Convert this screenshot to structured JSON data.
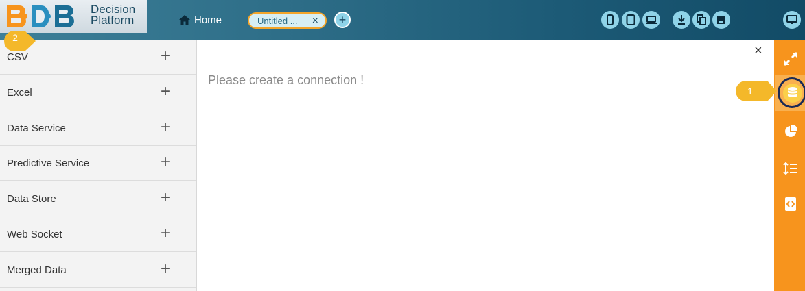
{
  "header": {
    "logo_line1": "Decision",
    "logo_line2": "Platform",
    "home_label": "Home",
    "tab_label": "Untitled ...",
    "tab_close": "×",
    "add_tab": "+"
  },
  "toolbar": {
    "buttons": [
      "mobile-view",
      "tablet-view",
      "laptop-view",
      "download",
      "copy",
      "save",
      "preview"
    ]
  },
  "left_panel": {
    "items": [
      {
        "label": "CSV",
        "action": "+"
      },
      {
        "label": "Excel",
        "action": "+"
      },
      {
        "label": "Data Service",
        "action": "+"
      },
      {
        "label": "Predictive Service",
        "action": "+"
      },
      {
        "label": "Data Store",
        "action": "+"
      },
      {
        "label": "Web Socket",
        "action": "+"
      },
      {
        "label": "Merged Data",
        "action": "+"
      }
    ]
  },
  "main": {
    "message": "Please create a connection !",
    "close": "×"
  },
  "callouts": {
    "one": "1",
    "two": "2"
  },
  "colors": {
    "rail": "#f7941d",
    "callout": "#f4b82a",
    "topbar": "#1c5a76",
    "tab_border": "#f4a52a"
  }
}
